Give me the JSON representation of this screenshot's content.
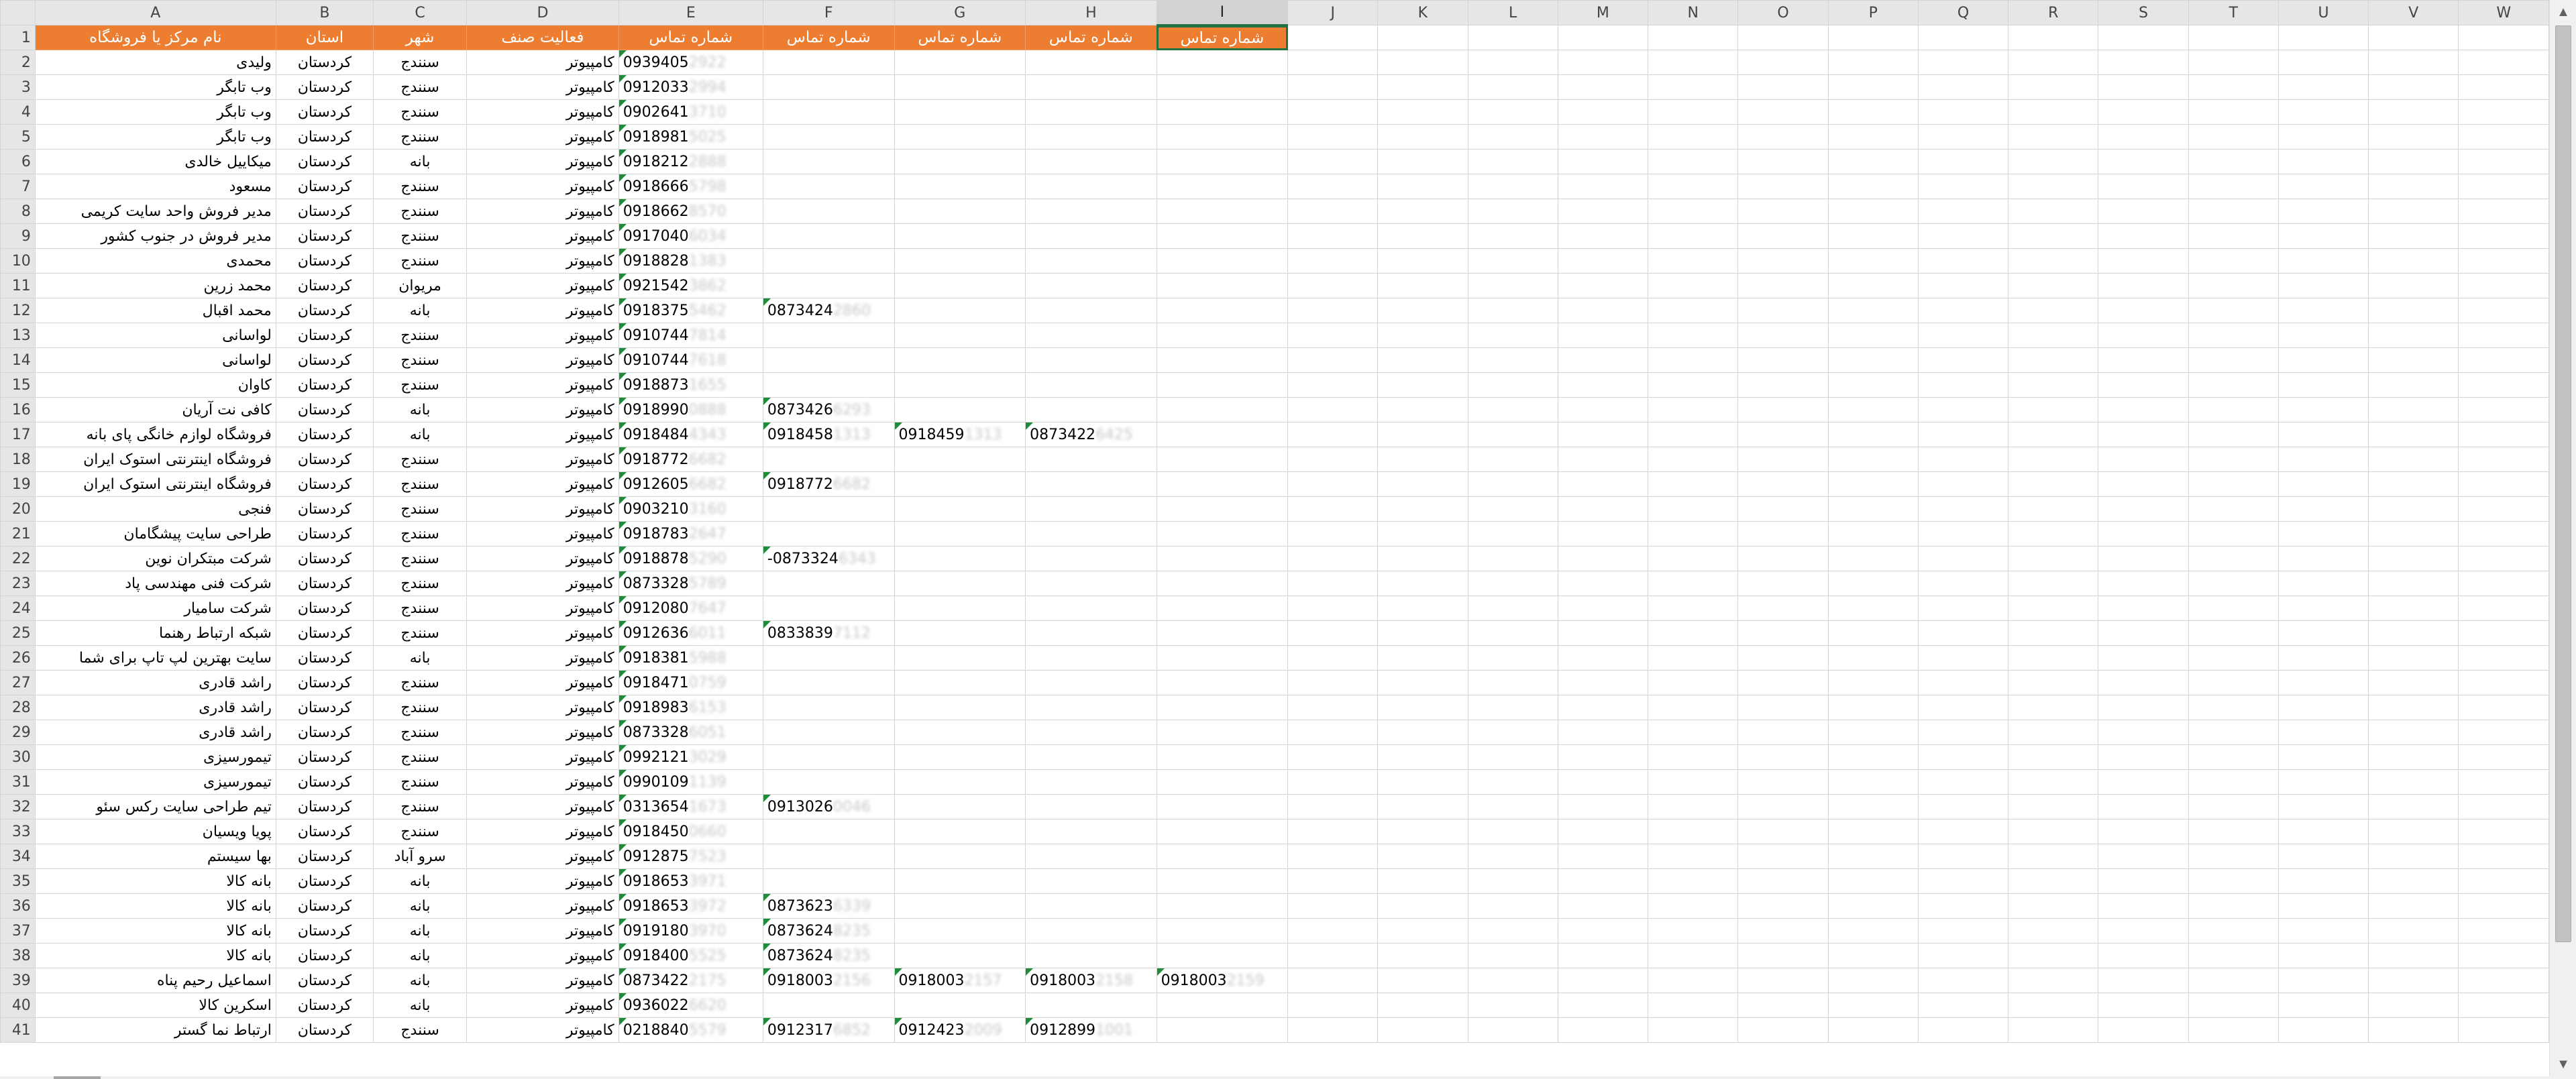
{
  "columns": [
    "A",
    "B",
    "C",
    "D",
    "E",
    "F",
    "G",
    "H",
    "I",
    "J",
    "K",
    "L",
    "M",
    "N",
    "O",
    "P",
    "Q",
    "R",
    "S",
    "T",
    "U",
    "V",
    "W"
  ],
  "header": {
    "name": "نام مرکز یا فروشگاه",
    "province": "استان",
    "city": "شهر",
    "activity": "فعالیت صنف",
    "phone1": "شماره تماس",
    "phone2": "شماره تماس",
    "phone3": "شماره تماس",
    "phone4": "شماره تماس",
    "phone5": "شماره تماس"
  },
  "accent_color": "#ed7d31",
  "rows": [
    {
      "n": "2",
      "name": "ولیدی",
      "prov": "کردستان",
      "city": "سنندج",
      "act": "کامپیوتر",
      "p": [
        [
          "0939405",
          "2922"
        ]
      ]
    },
    {
      "n": "3",
      "name": "وب تابگر",
      "prov": "کردستان",
      "city": "سنندج",
      "act": "کامپیوتر",
      "p": [
        [
          "0912033",
          "2994"
        ]
      ]
    },
    {
      "n": "4",
      "name": "وب تابگر",
      "prov": "کردستان",
      "city": "سنندج",
      "act": "کامپیوتر",
      "p": [
        [
          "0902641",
          "3710"
        ]
      ]
    },
    {
      "n": "5",
      "name": "وب تابگر",
      "prov": "کردستان",
      "city": "سنندج",
      "act": "کامپیوتر",
      "p": [
        [
          "0918981",
          "5025"
        ]
      ]
    },
    {
      "n": "6",
      "name": "میکاییل خالدی",
      "prov": "کردستان",
      "city": "بانه",
      "act": "کامپیوتر",
      "p": [
        [
          "0918212",
          "2888"
        ]
      ]
    },
    {
      "n": "7",
      "name": "مسعود",
      "prov": "کردستان",
      "city": "سنندج",
      "act": "کامپیوتر",
      "p": [
        [
          "0918666",
          "5798"
        ]
      ]
    },
    {
      "n": "8",
      "name": "مدیر فروش واحد سایت کریمی",
      "prov": "کردستان",
      "city": "سنندج",
      "act": "کامپیوتر",
      "p": [
        [
          "0918662",
          "8570"
        ]
      ]
    },
    {
      "n": "9",
      "name": "مدیر فروش در جنوب کشور",
      "prov": "کردستان",
      "city": "سنندج",
      "act": "کامپیوتر",
      "p": [
        [
          "0917040",
          "6034"
        ]
      ]
    },
    {
      "n": "10",
      "name": "محمدی",
      "prov": "کردستان",
      "city": "سنندج",
      "act": "کامپیوتر",
      "p": [
        [
          "0918828",
          "1383"
        ]
      ]
    },
    {
      "n": "11",
      "name": "محمد زرین",
      "prov": "کردستان",
      "city": "مریوان",
      "act": "کامپیوتر",
      "p": [
        [
          "0921542",
          "3862"
        ]
      ]
    },
    {
      "n": "12",
      "name": "محمد اقبال",
      "prov": "کردستان",
      "city": "بانه",
      "act": "کامپیوتر",
      "p": [
        [
          "0918375",
          "5462"
        ],
        [
          "0873424",
          "2860"
        ]
      ]
    },
    {
      "n": "13",
      "name": "لواسانی",
      "prov": "کردستان",
      "city": "سنندج",
      "act": "کامپیوتر",
      "p": [
        [
          "0910744",
          "7814"
        ]
      ]
    },
    {
      "n": "14",
      "name": "لواسانی",
      "prov": "کردستان",
      "city": "سنندج",
      "act": "کامپیوتر",
      "p": [
        [
          "0910744",
          "7618"
        ]
      ]
    },
    {
      "n": "15",
      "name": "کاوان",
      "prov": "کردستان",
      "city": "سنندج",
      "act": "کامپیوتر",
      "p": [
        [
          "0918873",
          "1655"
        ]
      ]
    },
    {
      "n": "16",
      "name": "کافی نت آریان",
      "prov": "کردستان",
      "city": "بانه",
      "act": "کامپیوتر",
      "p": [
        [
          "0918990",
          "0888"
        ],
        [
          "0873426",
          "6293"
        ]
      ]
    },
    {
      "n": "17",
      "name": "فروشگاه لوازم خانگی پای بانه",
      "prov": "کردستان",
      "city": "بانه",
      "act": "کامپیوتر",
      "p": [
        [
          "0918484",
          "4343"
        ],
        [
          "0918458",
          "1313"
        ],
        [
          "0918459",
          "1313"
        ],
        [
          "0873422",
          "6425"
        ]
      ]
    },
    {
      "n": "18",
      "name": "فروشگاه اینترنتی استوک ایران",
      "prov": "کردستان",
      "city": "سنندج",
      "act": "کامپیوتر",
      "p": [
        [
          "0918772",
          "6682"
        ]
      ]
    },
    {
      "n": "19",
      "name": "فروشگاه اینترنتی استوک ایران",
      "prov": "کردستان",
      "city": "سنندج",
      "act": "کامپیوتر",
      "p": [
        [
          "0912605",
          "6682"
        ],
        [
          "0918772",
          "6682"
        ]
      ]
    },
    {
      "n": "20",
      "name": "فنجی",
      "prov": "کردستان",
      "city": "سنندج",
      "act": "کامپیوتر",
      "p": [
        [
          "0903210",
          "3160"
        ]
      ]
    },
    {
      "n": "21",
      "name": "طراحی سایت پیشگامان",
      "prov": "کردستان",
      "city": "سنندج",
      "act": "کامپیوتر",
      "p": [
        [
          "0918783",
          "2647"
        ]
      ]
    },
    {
      "n": "22",
      "name": "شرکت مبتکران نوین",
      "prov": "کردستان",
      "city": "سنندج",
      "act": "کامپیوتر",
      "p": [
        [
          "0918878",
          "5290"
        ],
        [
          "-0873324",
          "6343"
        ]
      ]
    },
    {
      "n": "23",
      "name": "شرکت فنی مهندسی پاد",
      "prov": "کردستان",
      "city": "سنندج",
      "act": "کامپیوتر",
      "p": [
        [
          "0873328",
          "5789"
        ]
      ]
    },
    {
      "n": "24",
      "name": "شرکت سامیار",
      "prov": "کردستان",
      "city": "سنندج",
      "act": "کامپیوتر",
      "p": [
        [
          "0912080",
          "7647"
        ]
      ]
    },
    {
      "n": "25",
      "name": "شبکه ارتباط رهنما",
      "prov": "کردستان",
      "city": "سنندج",
      "act": "کامپیوتر",
      "p": [
        [
          "0912636",
          "6011"
        ],
        [
          "0833839",
          "7112"
        ]
      ]
    },
    {
      "n": "26",
      "name": "سایت بهترین لپ تاپ برای شما",
      "prov": "کردستان",
      "city": "بانه",
      "act": "کامپیوتر",
      "p": [
        [
          "0918381",
          "5988"
        ]
      ]
    },
    {
      "n": "27",
      "name": "راشد قادری",
      "prov": "کردستان",
      "city": "سنندج",
      "act": "کامپیوتر",
      "p": [
        [
          "0918471",
          "0759"
        ]
      ]
    },
    {
      "n": "28",
      "name": "راشد قادری",
      "prov": "کردستان",
      "city": "سنندج",
      "act": "کامپیوتر",
      "p": [
        [
          "0918983",
          "6153"
        ]
      ]
    },
    {
      "n": "29",
      "name": "راشد قادری",
      "prov": "کردستان",
      "city": "سنندج",
      "act": "کامپیوتر",
      "p": [
        [
          "0873328",
          "6051"
        ]
      ]
    },
    {
      "n": "30",
      "name": "تیمورسیزی",
      "prov": "کردستان",
      "city": "سنندج",
      "act": "کامپیوتر",
      "p": [
        [
          "0992121",
          "3029"
        ]
      ]
    },
    {
      "n": "31",
      "name": "تیمورسیزی",
      "prov": "کردستان",
      "city": "سنندج",
      "act": "کامپیوتر",
      "p": [
        [
          "0990109",
          "1139"
        ]
      ]
    },
    {
      "n": "32",
      "name": "تیم طراحی سایت رکس سئو",
      "prov": "کردستان",
      "city": "سنندج",
      "act": "کامپیوتر",
      "p": [
        [
          "0313654",
          "1673"
        ],
        [
          "0913026",
          "0046"
        ]
      ]
    },
    {
      "n": "33",
      "name": "پویا ویسیان",
      "prov": "کردستان",
      "city": "سنندج",
      "act": "کامپیوتر",
      "p": [
        [
          "0918450",
          "0660"
        ]
      ]
    },
    {
      "n": "34",
      "name": "بها سیستم",
      "prov": "کردستان",
      "city": "سرو آباد",
      "act": "کامپیوتر",
      "p": [
        [
          "0912875",
          "7523"
        ]
      ]
    },
    {
      "n": "35",
      "name": "بانه کالا",
      "prov": "کردستان",
      "city": "بانه",
      "act": "کامپیوتر",
      "p": [
        [
          "0918653",
          "3971"
        ]
      ]
    },
    {
      "n": "36",
      "name": "بانه کالا",
      "prov": "کردستان",
      "city": "بانه",
      "act": "کامپیوتر",
      "p": [
        [
          "0918653",
          "3972"
        ],
        [
          "0873623",
          "6339"
        ]
      ]
    },
    {
      "n": "37",
      "name": "بانه کالا",
      "prov": "کردستان",
      "city": "بانه",
      "act": "کامپیوتر",
      "p": [
        [
          "0919180",
          "3970"
        ],
        [
          "0873624",
          "8235"
        ]
      ]
    },
    {
      "n": "38",
      "name": "بانه کالا",
      "prov": "کردستان",
      "city": "بانه",
      "act": "کامپیوتر",
      "p": [
        [
          "0918400",
          "5525"
        ],
        [
          "0873624",
          "8235"
        ]
      ]
    },
    {
      "n": "39",
      "name": "اسماعیل رحیم پناه",
      "prov": "کردستان",
      "city": "بانه",
      "act": "کامپیوتر",
      "p": [
        [
          "0873422",
          "2175"
        ],
        [
          "0918003",
          "2156"
        ],
        [
          "0918003",
          "2157"
        ],
        [
          "0918003",
          "2158"
        ],
        [
          "0918003",
          "2159"
        ]
      ]
    },
    {
      "n": "40",
      "name": "اسکرین کالا",
      "prov": "کردستان",
      "city": "بانه",
      "act": "کامپیوتر",
      "p": [
        [
          "0936022",
          "6620"
        ]
      ]
    },
    {
      "n": "41",
      "name": "ارتباط نما گستر",
      "prov": "کردستان",
      "city": "سنندج",
      "act": "کامپیوتر",
      "p": [
        [
          "0218840",
          "5579"
        ],
        [
          "0912317",
          "6852"
        ],
        [
          "0912423",
          "2009"
        ],
        [
          "0912899",
          "1001"
        ]
      ]
    }
  ]
}
